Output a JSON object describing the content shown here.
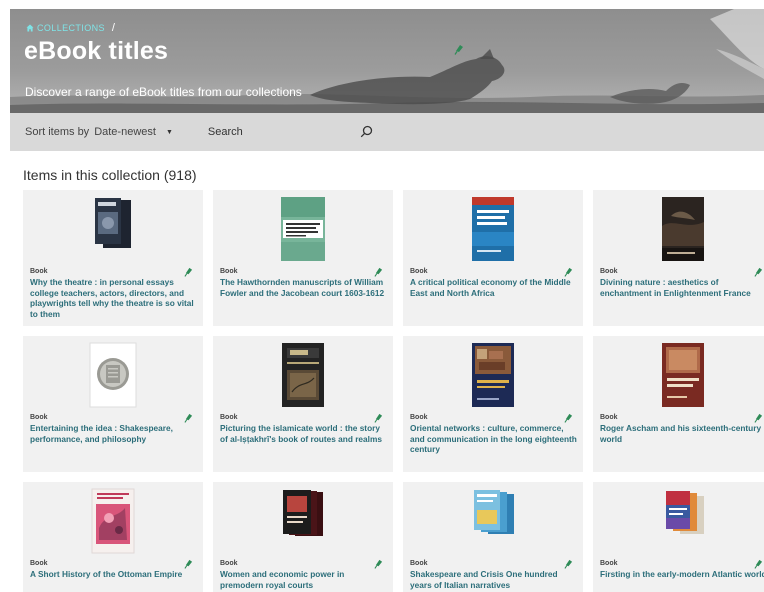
{
  "hero": {
    "breadcrumb": "COLLECTIONS",
    "breadcrumb_separator": "/",
    "title": "eBook titles",
    "subtitle": "Discover a range of eBook titles from our collections",
    "accent_color": "#7fe3e6"
  },
  "toolbar": {
    "sort_label": "Sort items by",
    "sort_value": "Date-newest",
    "search_placeholder": "Search"
  },
  "collection": {
    "heading": "Items in this collection (918)"
  },
  "items": [
    {
      "type": "Book",
      "title": "Why the theatre : in personal essays college teachers, actors, directors, and playwrights tell why the theatre is so vital to them"
    },
    {
      "type": "Book",
      "title": "The Hawthornden manuscripts of William Fowler and the Jacobean court 1603-1612"
    },
    {
      "type": "Book",
      "title": "A critical political economy of the Middle East and North Africa"
    },
    {
      "type": "Book",
      "title": "Divining nature : aesthetics of enchantment in Enlightenment France"
    },
    {
      "type": "Book",
      "title": "Entertaining the idea : Shakespeare, performance, and philosophy"
    },
    {
      "type": "Book",
      "title": "Picturing the islamicate world : the story of al-Iṣṭakhrī's book of routes and realms"
    },
    {
      "type": "Book",
      "title": "Oriental networks : culture, commerce, and communication in the long eighteenth century"
    },
    {
      "type": "Book",
      "title": "Roger Ascham and his sixteenth-century world"
    },
    {
      "type": "Book",
      "title": "A Short History of the Ottoman Empire"
    },
    {
      "type": "Book",
      "title": "Women and economic power in premodern royal courts"
    },
    {
      "type": "Book",
      "title": "Shakespeare and Crisis One hundred years of Italian narratives"
    },
    {
      "type": "Book",
      "title": "Firsting in the early-modern Atlantic world"
    }
  ],
  "colors": {
    "title_link": "#2c6e7a",
    "pin": "#2e8b57",
    "toolbar_bg": "#d9d9d9",
    "card_bg": "#f1f1f1"
  },
  "icons": {
    "home": "home-icon",
    "sort_caret": "caret-down-icon",
    "search": "search-icon",
    "pin": "pin-icon"
  }
}
